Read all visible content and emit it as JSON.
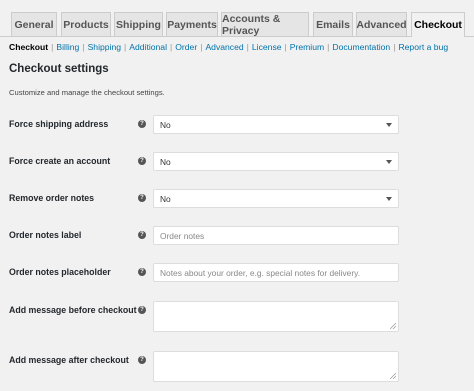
{
  "tabs": [
    "General",
    "Products",
    "Shipping",
    "Payments",
    "Accounts & Privacy",
    "Emails",
    "Advanced",
    "Checkout"
  ],
  "subnav": [
    "Checkout",
    "Billing",
    "Shipping",
    "Additional",
    "Order",
    "Advanced",
    "License",
    "Premium",
    "Documentation",
    "Report a bug"
  ],
  "heading": "Checkout settings",
  "description": "Customize and manage the checkout settings.",
  "fields": [
    {
      "label": "Force shipping address",
      "value": "No",
      "placeholder": ""
    },
    {
      "label": "Force create an account",
      "value": "No",
      "placeholder": ""
    },
    {
      "label": "Remove order notes",
      "value": "No",
      "placeholder": ""
    },
    {
      "label": "Order notes label",
      "value": "",
      "placeholder": "Order notes"
    },
    {
      "label": "Order notes placeholder",
      "value": "",
      "placeholder": "Notes about your order, e.g. special notes for delivery."
    },
    {
      "label": "Add message before checkout",
      "value": "",
      "placeholder": ""
    },
    {
      "label": "Add message after checkout",
      "value": "",
      "placeholder": ""
    }
  ],
  "help_glyph": "?"
}
